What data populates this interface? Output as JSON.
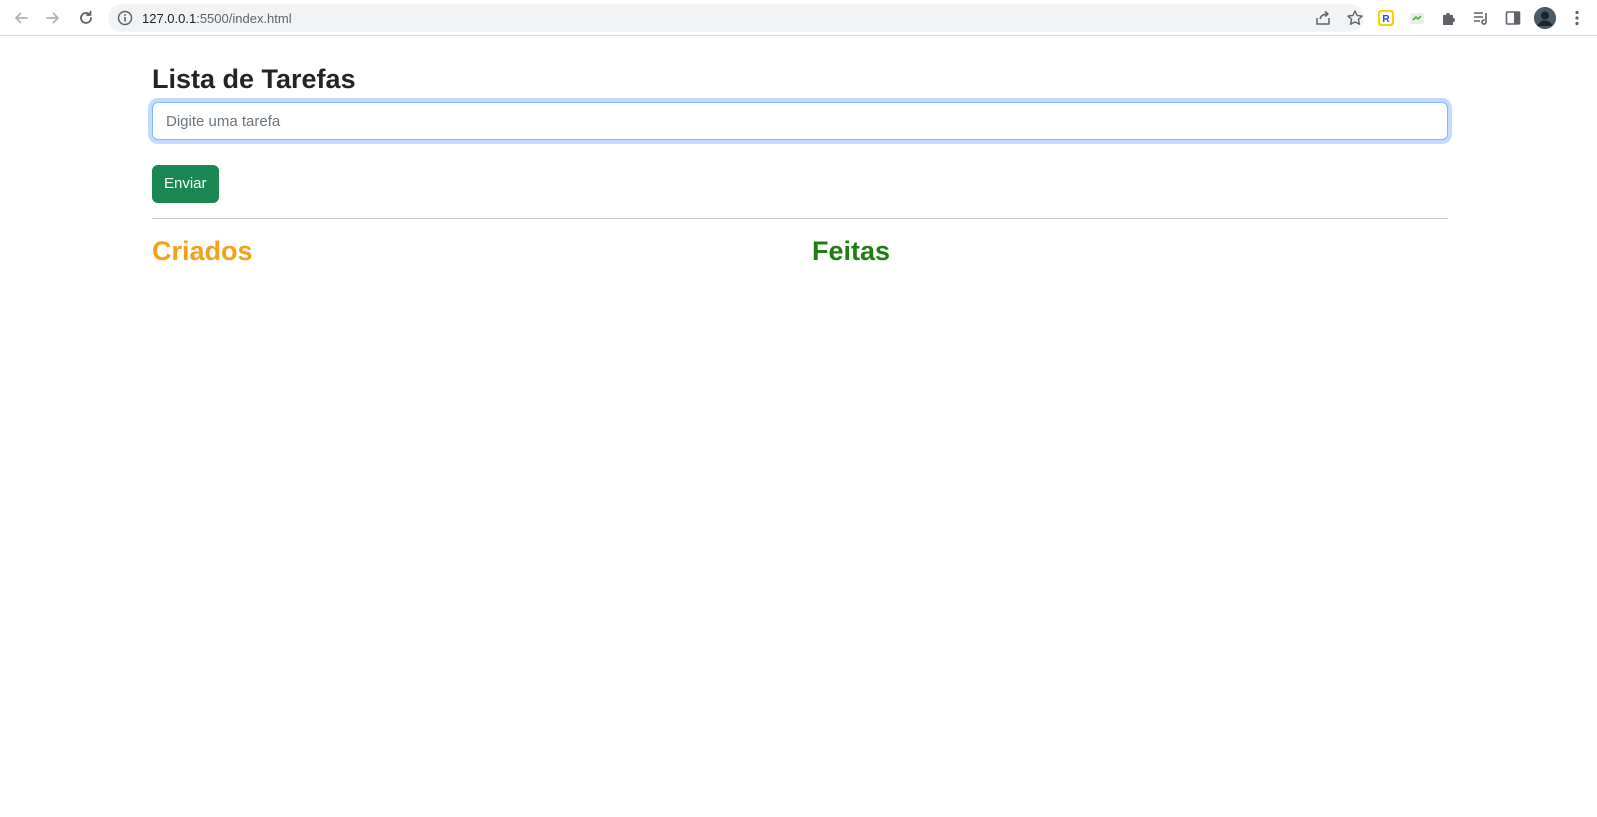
{
  "browser": {
    "url_host": "127.0.0.1",
    "url_path": ":5500/index.html",
    "icons": [
      "back-arrow-icon",
      "forward-arrow-icon",
      "reload-icon",
      "info-icon",
      "share-icon",
      "star-icon",
      "extension-r-icon",
      "extension-green-icon",
      "puzzle-icon",
      "reading-list-icon",
      "side-panel-icon",
      "profile-avatar",
      "menu-dots-icon"
    ]
  },
  "page": {
    "title": "Lista de Tarefas",
    "input_placeholder": "Digite uma tarefa",
    "input_value": "",
    "submit_label": "Enviar",
    "columns": {
      "created": {
        "heading": "Criados",
        "color": "#f5a01a"
      },
      "done": {
        "heading": "Feitas",
        "color": "#1e7e12"
      }
    }
  },
  "colors": {
    "button_bg": "#198754",
    "input_focus_border": "#86b7fe"
  }
}
